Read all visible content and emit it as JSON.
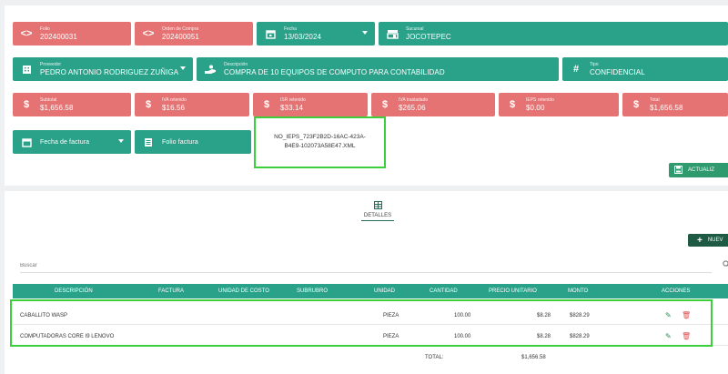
{
  "row1": {
    "folio": {
      "label": "Folio",
      "value": "202400031",
      "icon": "code-icon"
    },
    "orden": {
      "label": "Orden de Compra",
      "value": "202400051",
      "icon": "code-icon"
    },
    "fecha": {
      "label": "Fecha",
      "value": "13/03/2024",
      "icon": "calendar-icon"
    },
    "sucursal": {
      "label": "Sucursal",
      "value": "JOCOTEPEC",
      "icon": "store-icon"
    }
  },
  "row2": {
    "proveedor": {
      "label": "Proveedor",
      "value": "PEDRO ANTONIO RODRIGUEZ ZUÑIGA",
      "icon": "building-icon"
    },
    "descripcion": {
      "label": "Descripción",
      "value": "COMPRA DE 10 EQUIPOS DE COMPUTO PARA CONTABILIDAD",
      "icon": "hand-icon"
    },
    "tipo": {
      "label": "Tipo",
      "value": "CONFIDENCIAL",
      "icon": "hash-icon"
    }
  },
  "row3": {
    "subtotal": {
      "label": "Subtotal",
      "value": "$1,656.58"
    },
    "iva_ret": {
      "label": "IVA retenido",
      "value": "$16.56"
    },
    "isr_ret": {
      "label": "ISR retenido",
      "value": "$33.14"
    },
    "iva_tras": {
      "label": "IVA trasladado",
      "value": "$265.06"
    },
    "ieps_ret": {
      "label": "IEPS retenido",
      "value": "$0.00"
    },
    "total": {
      "label": "Total",
      "value": "$1,656.58"
    },
    "currency_symbol": "$"
  },
  "row4": {
    "fecha_factura": "Fecha de factura",
    "folio_factura": "Folio factura",
    "xml_line1": "NO_IEPS_723F2B2D-16AC-423A-",
    "xml_line2": "B4E9-102073A58E47.XML"
  },
  "actualizar_label": "ACTUALIZ",
  "tab_label": "DETALLES",
  "nuevo_label": "NUEV",
  "search": {
    "placeholder": "Buscar"
  },
  "table": {
    "headers": [
      "DESCRIPCIÓN",
      "FACTURA",
      "UNIDAD DE COSTO",
      "SUBRUBRO",
      "UNIDAD",
      "CANTIDAD",
      "PRECIO UNITARIO",
      "MONTO",
      "ACCIONES"
    ],
    "rows": [
      {
        "descripcion": "CABALLITO WASP",
        "unidad": "PIEZA",
        "cantidad": "100.00",
        "precio": "$8.28",
        "monto": "$828.29"
      },
      {
        "descripcion": "COMPUTADORAS CORE I9 LENOVO",
        "unidad": "PIEZA",
        "cantidad": "100.00",
        "precio": "$8.28",
        "monto": "$828.29"
      }
    ],
    "total_label": "TOTAL:",
    "total_value": "$1,656.58"
  },
  "colors": {
    "red": "#e57373",
    "teal": "#2aa189",
    "dark_green": "#1f5a45",
    "highlight": "#3ccf3c"
  }
}
